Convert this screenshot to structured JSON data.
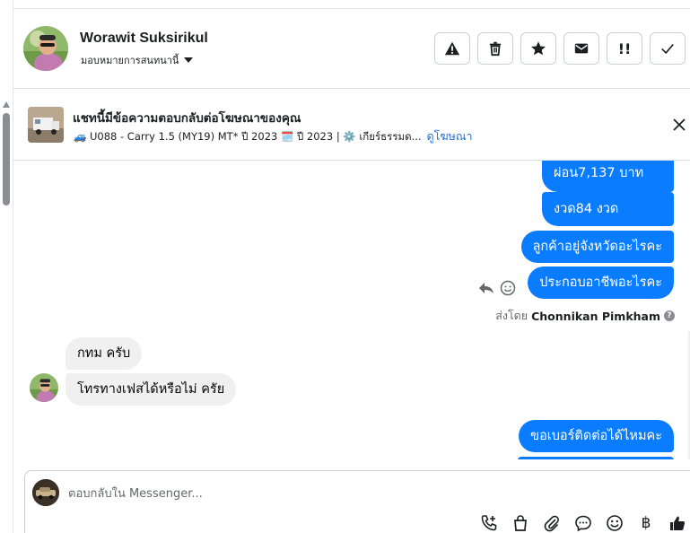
{
  "header": {
    "name": "Worawit Suksirikul",
    "assign_label": "มอบหมายการสนทนานี้",
    "actions": [
      "report",
      "delete",
      "star",
      "mark-unread",
      "mark-spam",
      "done"
    ],
    "action_glyph_spam": "!!"
  },
  "ad_banner": {
    "title": "แชทนี้มีข้อความตอบกลับต่อโฆษณาของคุณ",
    "detail": "🚙 U088 - Carry 1.5 (MY19) MT* ปี 2023 🗓️ ปี 2023 | ⚙️ เกียร์ธรรมด...",
    "link": "ดูโฆษณา"
  },
  "messages": {
    "outgoing": [
      {
        "text": "ผ่อน7,137 บาท"
      },
      {
        "text": "งวด84 งวด"
      },
      {
        "text": "ลูกค้าอยู่จังหวัดอะไรคะ"
      },
      {
        "text": "ประกอบอาชีพอะไรคะ"
      },
      {
        "text": "ขอเบอร์ติดต่อได้ไหมคะ"
      }
    ],
    "sent_by_prefix": "ส่งโดย",
    "sent_by_name": "Chonnikan Pimkham",
    "help_glyph": "?",
    "incoming": [
      {
        "text": "กทม ครับ"
      },
      {
        "text": "โทรทางเฟสได้หรือไม่ ครัย"
      }
    ]
  },
  "composer": {
    "placeholder": "ตอบกลับใน Messenger...",
    "currency_glyph": "฿"
  },
  "colors": {
    "outgoing_bubble": "#0a7cff",
    "incoming_bubble": "#f0f0f0",
    "link": "#216fdb"
  }
}
